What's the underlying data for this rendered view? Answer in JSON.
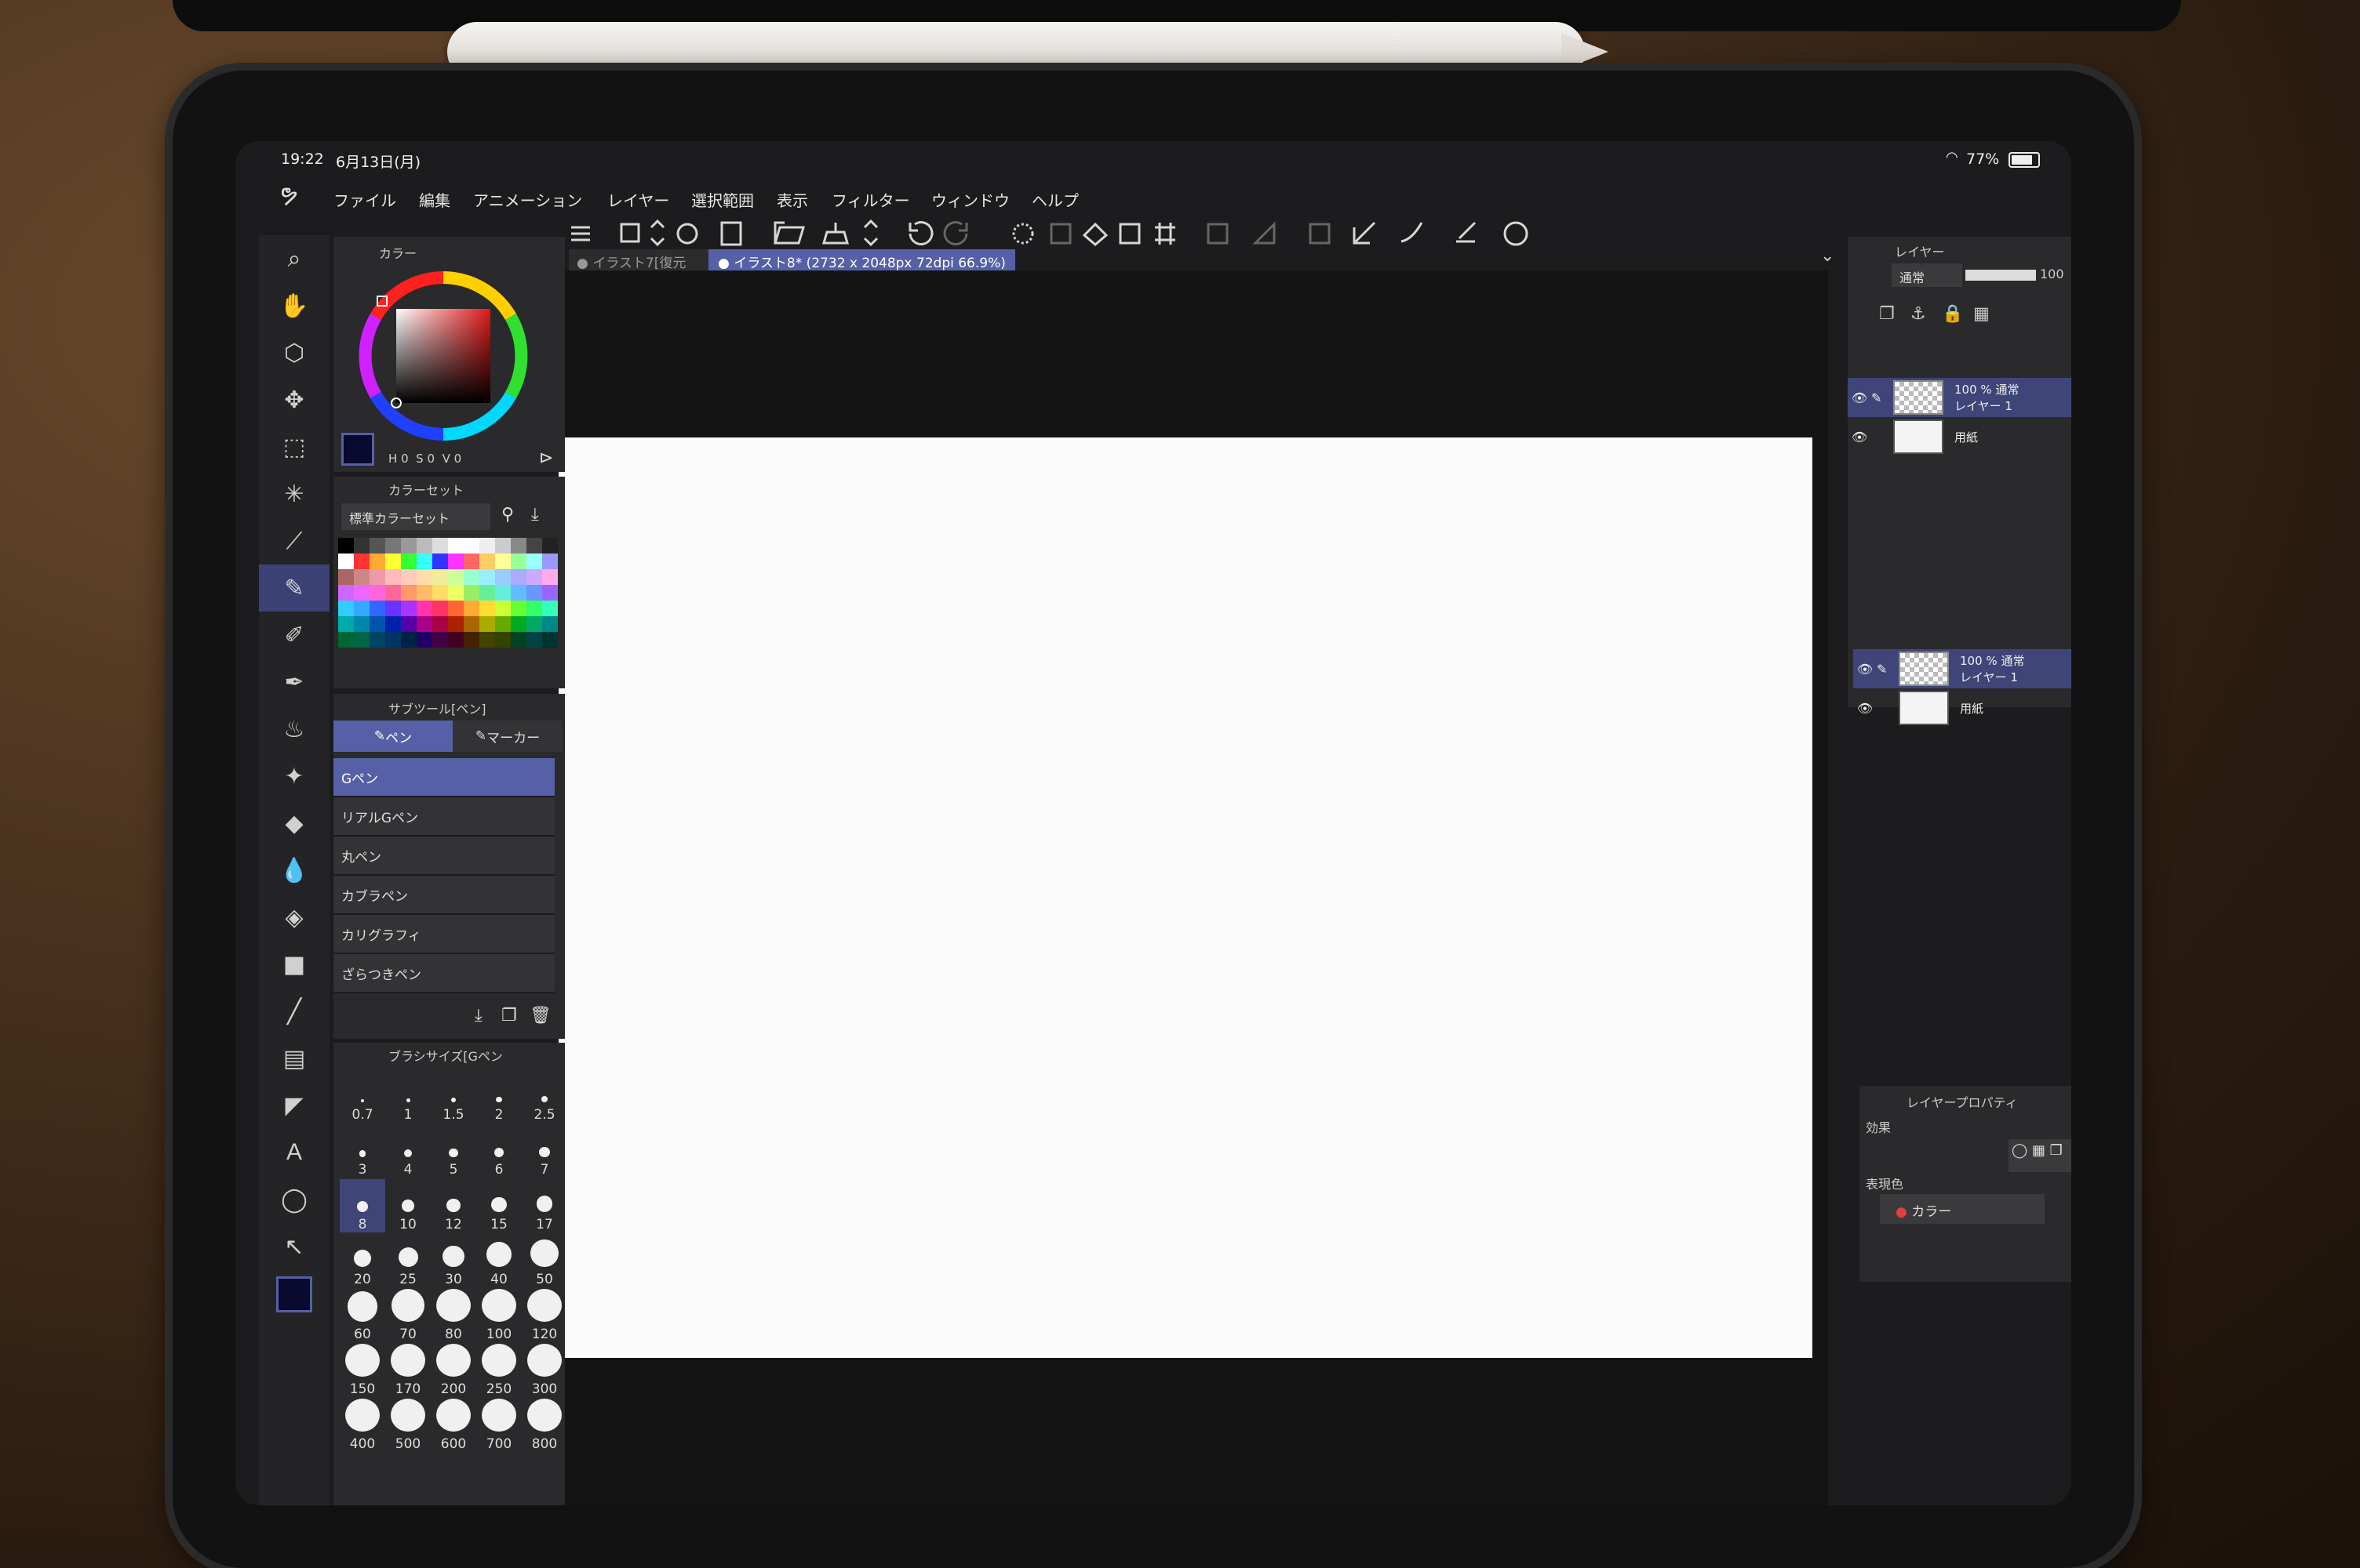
{
  "status": {
    "time": "19:22",
    "date": "6月13日(月)",
    "battery": "77%"
  },
  "menu": [
    "ファイル",
    "編集",
    "アニメーション",
    "レイヤー",
    "選択範囲",
    "表示",
    "フィルター",
    "ウィンドウ",
    "ヘルプ"
  ],
  "tabs": [
    {
      "label": "● イラスト7[復元",
      "active": false
    },
    {
      "label": "● イラスト8* (2732 x 2048px 72dpi 66.9%)",
      "active": true
    }
  ],
  "color_panel": {
    "title": "カラー",
    "h_label": "H",
    "h_value": "0",
    "s_label": "S",
    "s_value": "0",
    "v_label": "V",
    "v_value": "0"
  },
  "color_set": {
    "title": "カラーセット",
    "set_name": "標準カラーセット"
  },
  "subtool": {
    "title": "サブツール[ペン]",
    "tab_pen": "ペン",
    "tab_marker": "マーカー",
    "items": [
      "Gペン",
      "リアルGペン",
      "丸ペン",
      "カブラペン",
      "カリグラフィ",
      "ざらつきペン"
    ],
    "selected": "Gペン"
  },
  "brush_size": {
    "title": "ブラシサイズ[Gペン",
    "sizes": [
      "0.7",
      "1",
      "1.5",
      "2",
      "2.5",
      "3",
      "4",
      "5",
      "6",
      "7",
      "8",
      "10",
      "12",
      "15",
      "17",
      "20",
      "25",
      "30",
      "40",
      "50",
      "60",
      "70",
      "80",
      "100",
      "120",
      "150",
      "170",
      "200",
      "250",
      "300",
      "400",
      "500",
      "600",
      "700",
      "800"
    ],
    "selected": "8"
  },
  "layer_panel": {
    "title": "レイヤー",
    "blend_mode": "通常",
    "opacity": "100",
    "layers": [
      {
        "percent": "100 %",
        "mode": "通常",
        "name": "レイヤー 1",
        "selected": true
      },
      {
        "name": "用紙",
        "selected": false
      }
    ]
  },
  "layer_list_duplicate": [
    {
      "percent": "100 %",
      "mode": "通常",
      "name": "レイヤー 1",
      "selected": true
    },
    {
      "name": "用紙",
      "selected": false
    }
  ],
  "layer_property": {
    "title": "レイヤープロパティ",
    "effect_label": "効果",
    "expression_label": "表現色",
    "expression_value": "カラー"
  },
  "colors": {
    "accent": "#5560a6",
    "panel": "#2a2a2c",
    "paper": "#fbfbfb"
  }
}
